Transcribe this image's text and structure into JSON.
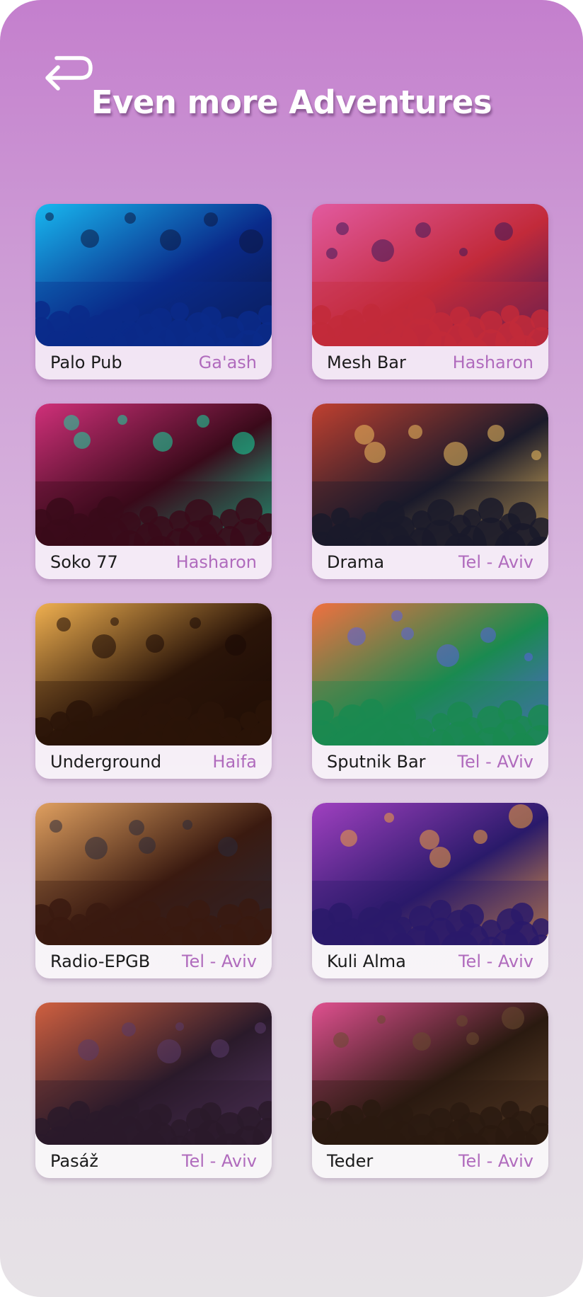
{
  "header": {
    "back_icon": "return-arrow-icon",
    "title": "Even more Adventures"
  },
  "colors": {
    "accent": "#b06bbd",
    "gradient_top": "#c47fcd",
    "gradient_bottom": "#e6e2e6"
  },
  "venues": [
    {
      "name": "Palo Pub",
      "location": "Ga'ash",
      "theme": [
        "#0a2a8a",
        "#18b8f0",
        "#0c1640"
      ]
    },
    {
      "name": "Mesh Bar",
      "location": "Hasharon",
      "theme": [
        "#c22a3a",
        "#e25aa0",
        "#3a1a5a"
      ]
    },
    {
      "name": "Soko 77",
      "location": "Hasharon",
      "theme": [
        "#3a0a1a",
        "#d0307a",
        "#16d8a0"
      ]
    },
    {
      "name": "Drama",
      "location": "Tel - Aviv",
      "theme": [
        "#1a1a2a",
        "#c04030",
        "#f0c060"
      ]
    },
    {
      "name": "Underground",
      "location": "Haifa",
      "theme": [
        "#2a1408",
        "#f0b050",
        "#1a0a05"
      ]
    },
    {
      "name": "Sputnik Bar",
      "location": "Tel - AViv",
      "theme": [
        "#1a8a50",
        "#f07040",
        "#5a60e0"
      ]
    },
    {
      "name": "Radio-EPGB",
      "location": "Tel - Aviv",
      "theme": [
        "#3a1a10",
        "#e0a060",
        "#2a2a3a"
      ]
    },
    {
      "name": "Kuli Alma",
      "location": "Tel - Aviv",
      "theme": [
        "#2a1a6a",
        "#a040c0",
        "#f0a040"
      ]
    },
    {
      "name": "Pasáž",
      "location": "Tel - Aviv",
      "theme": [
        "#2a1a2a",
        "#d06040",
        "#5a3a6a"
      ]
    },
    {
      "name": "Teder",
      "location": "Tel - Aviv",
      "theme": [
        "#2a1a10",
        "#e05090",
        "#6a4a30"
      ]
    }
  ]
}
